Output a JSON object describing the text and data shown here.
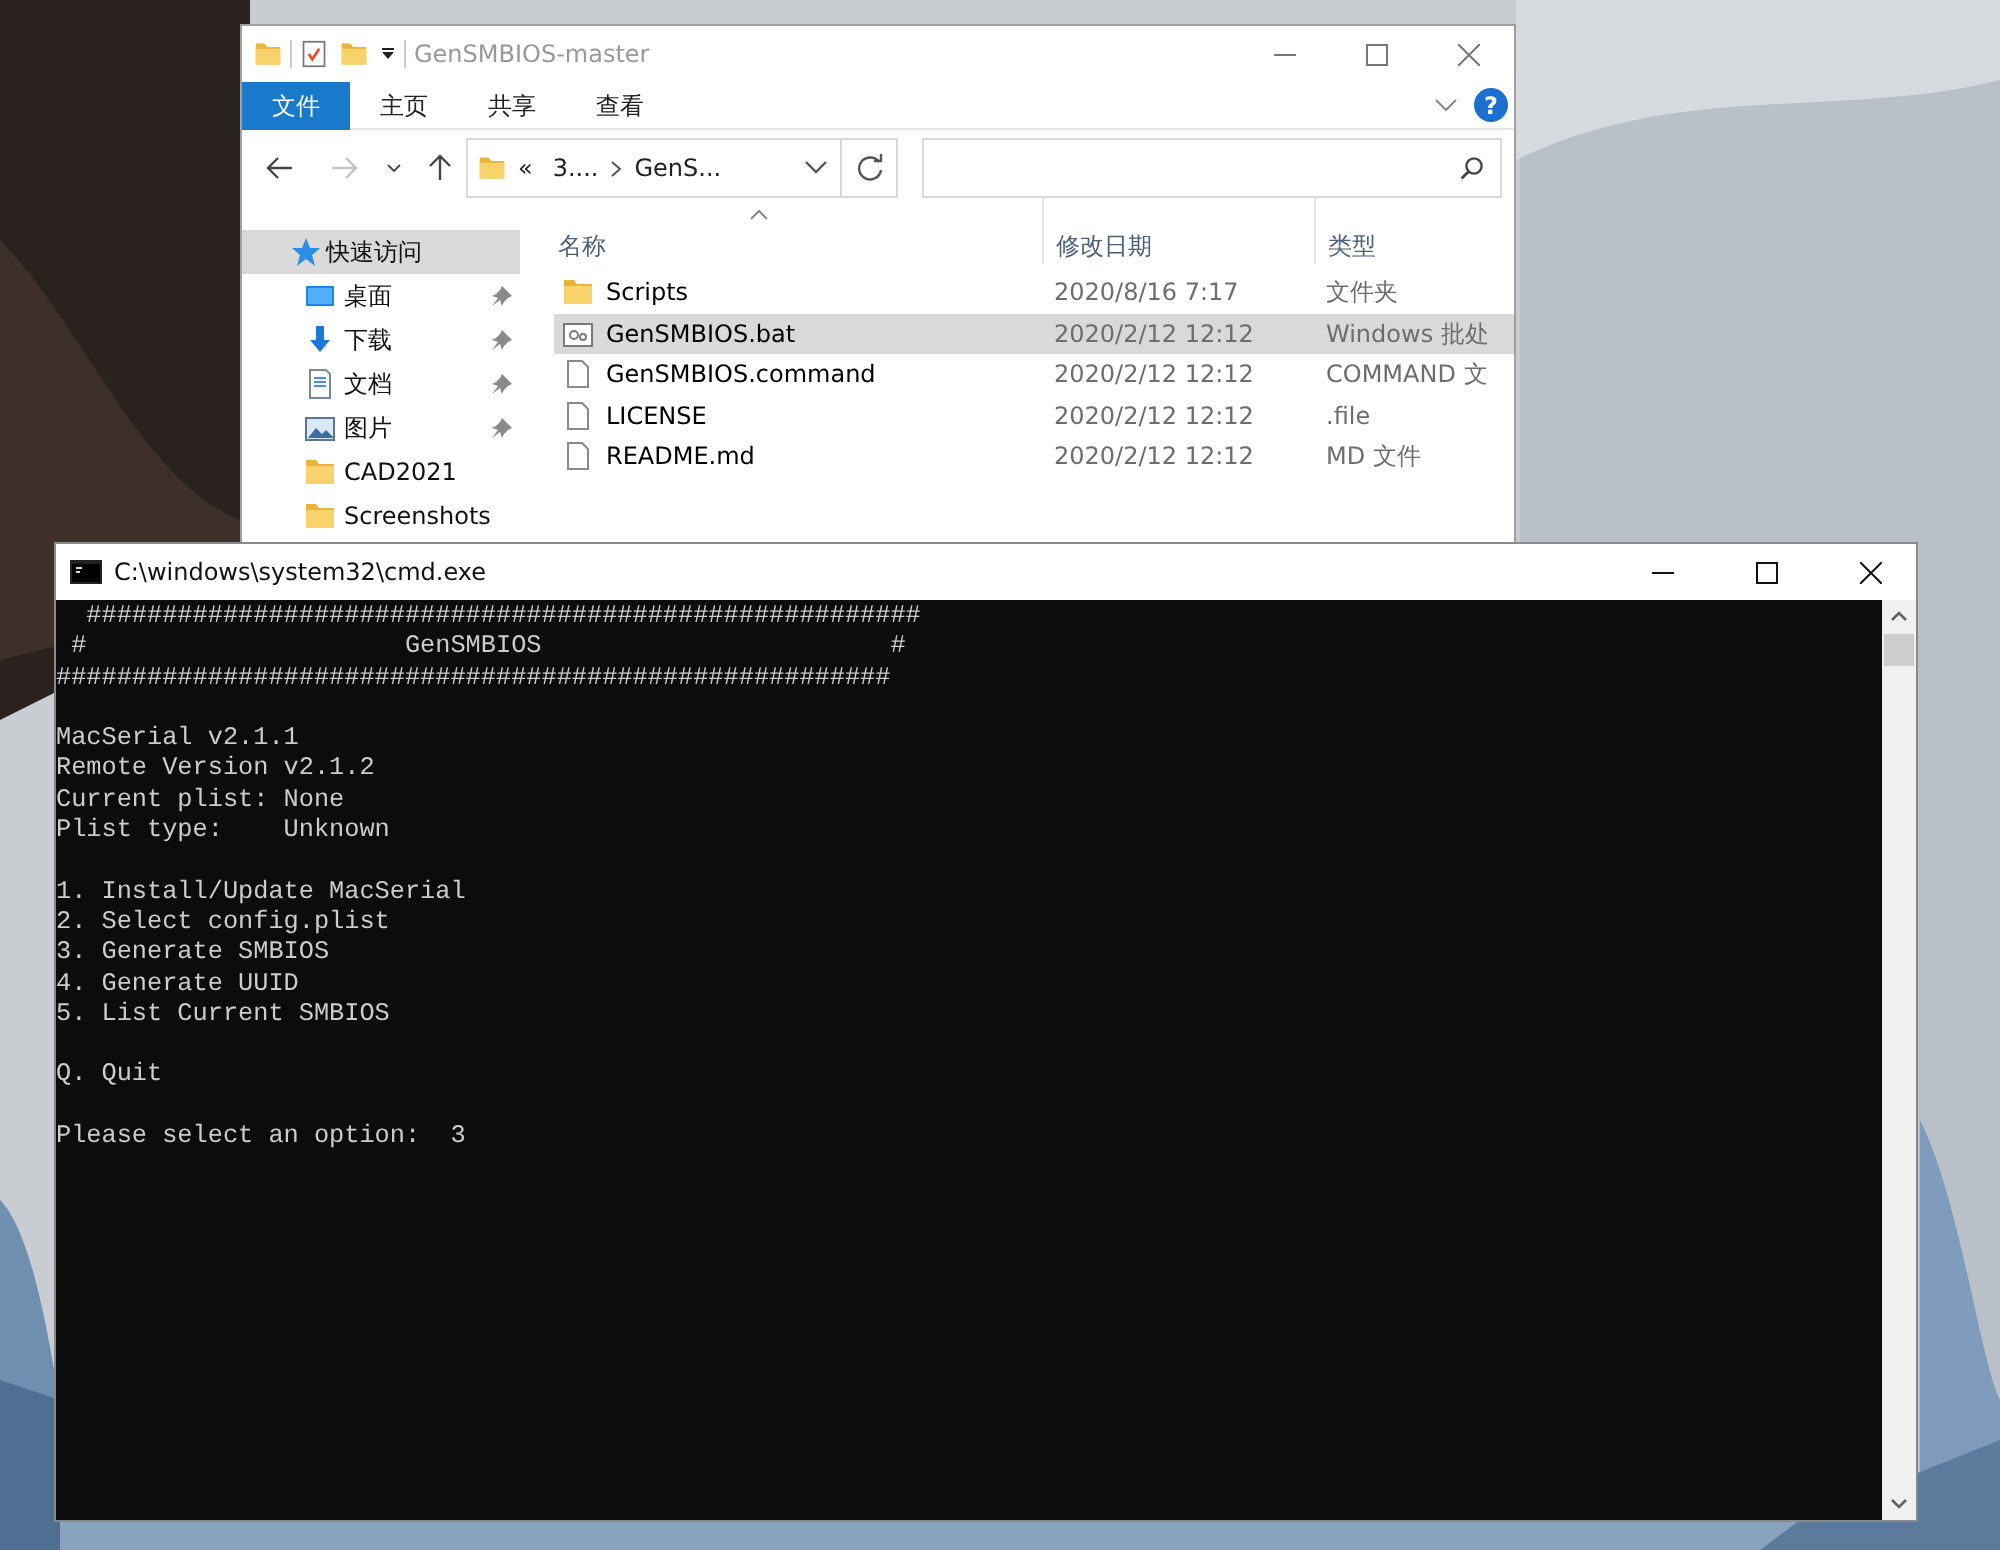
{
  "explorer": {
    "title": "GenSMBIOS-master",
    "ribbon_tabs": [
      {
        "label": "文件",
        "selected": true
      },
      {
        "label": "主页",
        "selected": false
      },
      {
        "label": "共享",
        "selected": false
      },
      {
        "label": "查看",
        "selected": false
      }
    ],
    "help_glyph": "?",
    "nav_buttons": [
      {
        "kind": "back",
        "disabled": false
      },
      {
        "kind": "forward",
        "disabled": true
      },
      {
        "kind": "recent",
        "disabled": false
      },
      {
        "kind": "up",
        "disabled": false
      }
    ],
    "address": {
      "overflow": "«",
      "crumbs": [
        "3....",
        "GenS..."
      ]
    },
    "nav_tree": [
      {
        "label": "快速访问",
        "kind": "star",
        "selected": true,
        "children": [
          {
            "label": "桌面",
            "kind": "desktop",
            "selected": false,
            "pinned": true
          },
          {
            "label": "下载",
            "kind": "download",
            "selected": false,
            "pinned": true
          },
          {
            "label": "文档",
            "kind": "document",
            "selected": false,
            "pinned": true
          },
          {
            "label": "图片",
            "kind": "pictures",
            "selected": false,
            "pinned": true
          },
          {
            "label": "CAD2021",
            "kind": "folder",
            "selected": false,
            "pinned": false
          },
          {
            "label": "Screenshots",
            "kind": "folder",
            "selected": false,
            "pinned": false
          }
        ]
      }
    ],
    "columns": [
      "名称",
      "修改日期",
      "类型"
    ],
    "files": [
      {
        "name": "Scripts",
        "modified": "2020/8/16 7:17",
        "type": "文件夹",
        "kind": "folder",
        "selected": false
      },
      {
        "name": "GenSMBIOS.bat",
        "modified": "2020/2/12 12:12",
        "type": "Windows 批处",
        "kind": "batch",
        "selected": true
      },
      {
        "name": "GenSMBIOS.command",
        "modified": "2020/2/12 12:12",
        "type": "COMMAND 文",
        "kind": "file",
        "selected": false
      },
      {
        "name": "LICENSE",
        "modified": "2020/2/12 12:12",
        "type": ".file",
        "kind": "file",
        "selected": false
      },
      {
        "name": "README.md",
        "modified": "2020/2/12 12:12",
        "type": "MD 文件",
        "kind": "file",
        "selected": false
      }
    ]
  },
  "console": {
    "title": "C:\\windows\\system32\\cmd.exe",
    "blocks": [
      [
        "  #######################################################",
        " #                     GenSMBIOS                       #",
        "#######################################################"
      ],
      [
        "MacSerial v2.1.1",
        "Remote Version v2.1.2",
        "Current plist: None",
        "Plist type:    Unknown"
      ],
      [
        "1. Install/Update MacSerial",
        "2. Select config.plist",
        "3. Generate SMBIOS",
        "4. Generate UUID",
        "5. List Current SMBIOS"
      ],
      [
        "Q. Quit"
      ],
      [
        "Please select an option:  3"
      ]
    ]
  }
}
